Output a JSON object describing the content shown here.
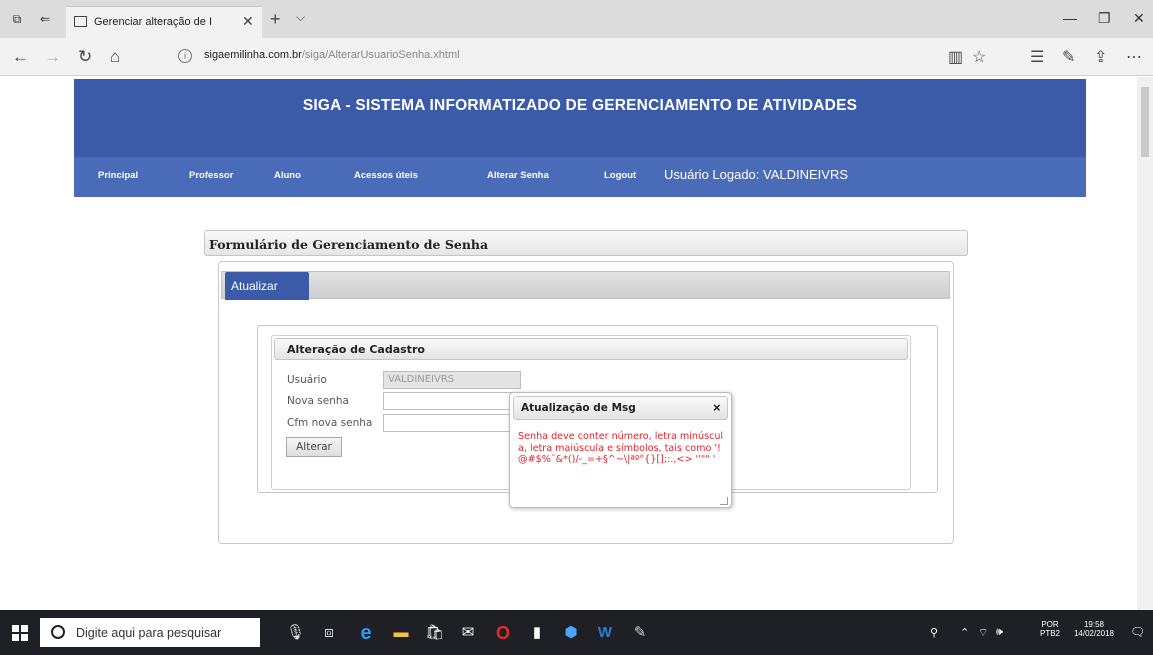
{
  "browser": {
    "tab_title": "Gerenciar alteração de I",
    "url_host": "sigaemilinha.com.br",
    "url_path": "/siga/AlterarUsuarioSenha.xhtml"
  },
  "site": {
    "title": "SIGA - SISTEMA INFORMATIZADO DE GERENCIAMENTO DE ATIVIDADES",
    "menu": [
      "Principal",
      "Professor",
      "Aluno",
      "Acessos úteis",
      "Alterar Senha",
      "Logout"
    ],
    "user_logged": "Usuário Logado: VALDINEIVRS"
  },
  "form": {
    "panel_title": "Formulário de Gerenciamento de Senha",
    "tab_label": "Atualizar",
    "legend": "Alteração de Cadastro",
    "user_label": "Usuário",
    "user_value": "VALDINEIVRS",
    "new_password_label": "Nova senha",
    "confirm_password_label": "Cfm nova senha",
    "submit_label": "Alterar"
  },
  "dialog": {
    "title": "Atualização de Msg",
    "close_symbol": "×",
    "message": "Senha deve conter número, letra minúscula, letra maiúscula e símbolos, tais como '!@#$%¨&*()/-_=+§^~\\|ªº°{}[];:.,<> ''\"\" '"
  },
  "taskbar": {
    "search_placeholder": "Digite aqui para pesquisar",
    "lang_top": "POR",
    "lang_bottom": "PTB2",
    "time": "19:58",
    "date": "14/02/2018"
  },
  "colors": {
    "header_blue": "#3b5ba8",
    "menu_blue": "#4a6cb8",
    "error_red": "#e8232a"
  }
}
